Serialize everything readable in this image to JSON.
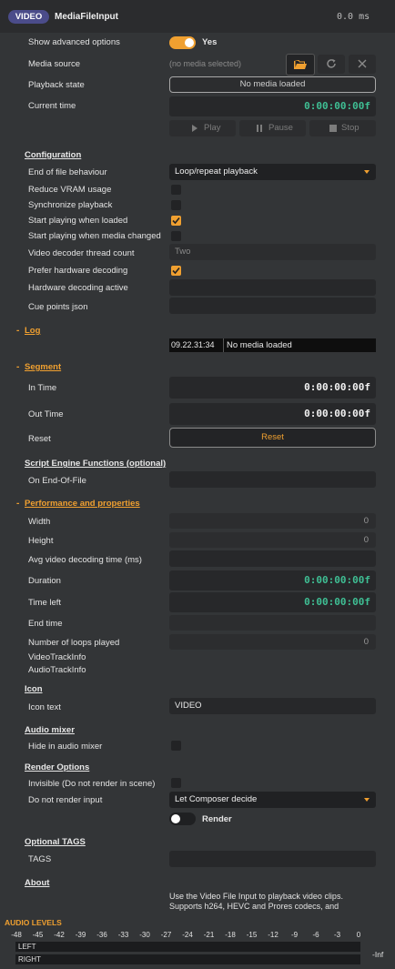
{
  "header": {
    "badge": "VIDEO",
    "title": "MediaFileInput",
    "time": "0.0 ms"
  },
  "rows": {
    "show_advanced": "Show advanced options",
    "show_advanced_value": "Yes",
    "media_source": "Media source",
    "media_source_value": "(no media selected)",
    "playback_state": "Playback state",
    "playback_state_value": "No media loaded",
    "current_time": "Current time",
    "current_time_value": "0:00:00:00f",
    "play": "Play",
    "pause": "Pause",
    "stop": "Stop"
  },
  "configuration": {
    "title": "Configuration",
    "end_of_file": "End of file behaviour",
    "end_of_file_value": "Loop/repeat playback",
    "reduce_vram": "Reduce VRAM usage",
    "reduce_vram_checked": false,
    "sync_playback": "Synchronize playback",
    "sync_playback_checked": false,
    "start_loaded": "Start playing when loaded",
    "start_loaded_checked": true,
    "start_changed": "Start playing when media changed",
    "start_changed_checked": false,
    "thread_count": "Video decoder thread count",
    "thread_count_value": "Two",
    "prefer_hw": "Prefer hardware decoding",
    "prefer_hw_checked": true,
    "hw_active": "Hardware decoding active",
    "cue_points": "Cue points json"
  },
  "log": {
    "dash": "-",
    "title": "Log",
    "time": "09.22.31:34",
    "message": "No media loaded"
  },
  "segment": {
    "dash": "-",
    "title": "Segment",
    "in_time": "In Time",
    "in_value": "0:00:00:00f",
    "out_time": "Out Time",
    "out_value": "0:00:00:00f",
    "reset": "Reset",
    "reset_button": "Reset"
  },
  "script": {
    "title": "Script Engine Functions (optional)",
    "on_eof": "On End-Of-File"
  },
  "performance": {
    "dash": "-",
    "title": "Performance and properties",
    "width": "Width",
    "width_value": "0",
    "height": "Height",
    "height_value": "0",
    "avg_decode": "Avg video decoding time (ms)",
    "duration": "Duration",
    "duration_value": "0:00:00:00f",
    "time_left": "Time left",
    "time_left_value": "0:00:00:00f",
    "end_time": "End time",
    "loops": "Number of loops played",
    "loops_value": "0",
    "video_track": "VideoTrackInfo",
    "audio_track": "AudioTrackInfo"
  },
  "icon": {
    "title": "Icon",
    "icon_text": "Icon text",
    "icon_text_value": "VIDEO"
  },
  "audio_mixer": {
    "title": "Audio mixer",
    "hide": "Hide in audio mixer",
    "hide_checked": false
  },
  "render": {
    "title": "Render Options",
    "invisible": "Invisible (Do not render in scene)",
    "invisible_checked": false,
    "no_render_input": "Do not render input",
    "no_render_input_value": "Let Composer decide",
    "render": "Render"
  },
  "tags": {
    "title": "Optional TAGS",
    "tags": "TAGS"
  },
  "about": {
    "title": "About",
    "line1": "Use the Video File Input to playback video clips.",
    "line2": "Supports h264, HEVC and Prores codecs, and"
  },
  "audio": {
    "title": "AUDIO LEVELS",
    "scale": [
      "-48",
      "-45",
      "-42",
      "-39",
      "-36",
      "-33",
      "-30",
      "-27",
      "-24",
      "-21",
      "-18",
      "-15",
      "-12",
      "-9",
      "-6",
      "-3",
      "0"
    ],
    "left": "LEFT",
    "right": "RIGHT",
    "inf": "-Inf"
  },
  "colors": {
    "accent": "#f0a030",
    "timecode": "#3fbf94",
    "badge": "#4b4c8a"
  }
}
